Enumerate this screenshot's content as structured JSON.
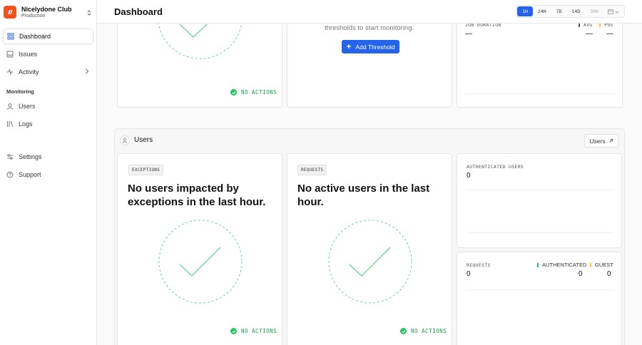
{
  "org": {
    "name": "Nicelydone Club",
    "environment": "Production"
  },
  "sidebar": {
    "items": [
      {
        "label": "Dashboard",
        "icon": "grid-icon"
      },
      {
        "label": "Issues",
        "icon": "inbox-icon"
      },
      {
        "label": "Activity",
        "icon": "activity-icon"
      }
    ],
    "section_label": "Monitoring",
    "monitoring_items": [
      {
        "label": "Users",
        "icon": "user-icon"
      },
      {
        "label": "Logs",
        "icon": "logs-icon"
      }
    ],
    "bottom_items": [
      {
        "label": "Settings",
        "icon": "sliders-icon"
      },
      {
        "label": "Support",
        "icon": "help-icon"
      }
    ]
  },
  "header": {
    "title": "Dashboard",
    "periods": [
      "1H",
      "24H",
      "7D",
      "14D",
      "30D"
    ],
    "selected_period": "1H"
  },
  "top_row": {
    "left": {
      "status": "NO ACTIONS"
    },
    "middle": {
      "text": "thresholds to start monitoring.",
      "button": "Add Threshold"
    },
    "right": {
      "label": "JOB DURATION",
      "value": "—",
      "legend_avg": "AVG",
      "legend_p95": "P95",
      "avg_value": "—",
      "p95_value": "—"
    }
  },
  "users_section": {
    "title": "Users",
    "button": "Users",
    "exceptions": {
      "badge": "EXCEPTIONS",
      "headline": "No users impacted by exceptions in the last hour.",
      "status": "NO ACTIONS"
    },
    "requests": {
      "badge": "REQUESTS",
      "headline": "No active users in the last hour.",
      "status": "NO ACTIONS"
    },
    "auth_users": {
      "label": "AUTHENTICATED USERS",
      "value": "0"
    },
    "requests_stats": {
      "label": "REQUESTS",
      "value": "0",
      "legend_auth": "AUTHENTICATED",
      "legend_guest": "GUEST",
      "auth_value": "0",
      "guest_value": "0"
    }
  },
  "colors": {
    "accent": "#2563eb",
    "success": "#22c55e",
    "brand": "#f4511e",
    "avg_series": "#22c55e",
    "p95_series": "#facc15"
  }
}
